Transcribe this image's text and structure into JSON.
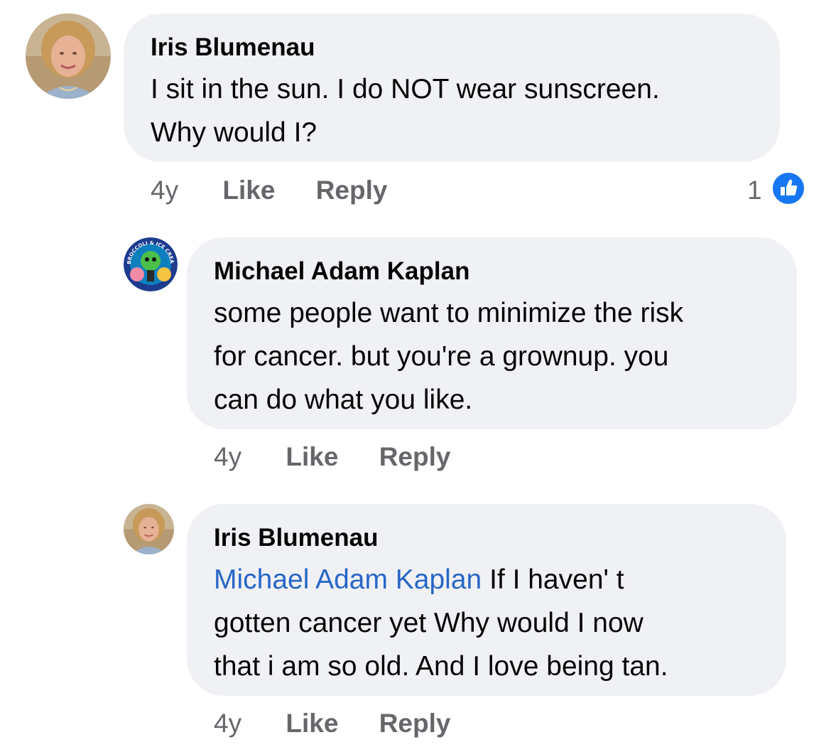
{
  "comments": [
    {
      "author": "Iris Blumenau",
      "lines": [
        "I sit in the sun.  I do NOT wear sunscreen.",
        "Why would I?"
      ],
      "time": "4y",
      "like_label": "Like",
      "reply_label": "Reply",
      "reaction_count": "1"
    },
    {
      "author": "Michael Adam Kaplan",
      "avatar_text": "BROCCOLI & ICE CREAM",
      "lines": [
        "some people want to minimize the risk",
        "for cancer. but you're a grownup. you",
        "can do what you like."
      ],
      "time": "4y",
      "like_label": "Like",
      "reply_label": "Reply"
    },
    {
      "author": "Iris Blumenau",
      "mention": "Michael Adam Kaplan",
      "lines": [
        " If I haven' t",
        "gotten cancer yet Why would I now",
        "that i am so old.  And I love being tan."
      ],
      "time": "4y",
      "like_label": "Like",
      "reply_label": "Reply"
    }
  ],
  "icons": {
    "reaction": "thumbs-up-icon"
  },
  "colors": {
    "bubble": "#f0f1f4",
    "mention": "#2866c7",
    "meta": "#65676b",
    "like_badge": "#1877f2"
  }
}
